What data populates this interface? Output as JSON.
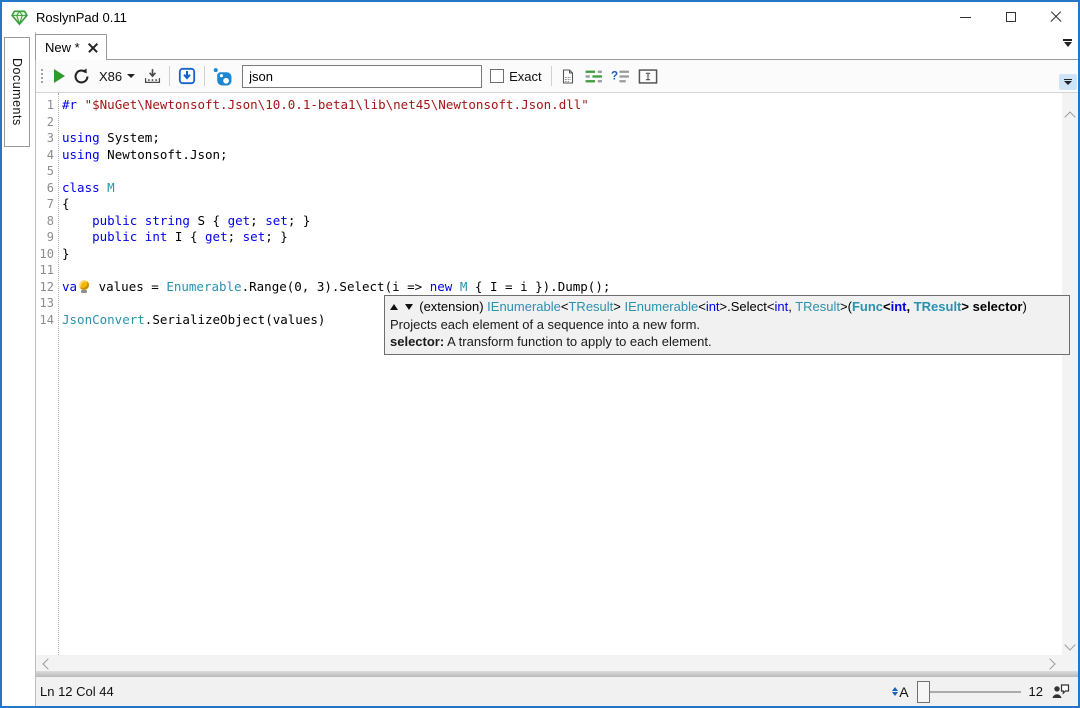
{
  "window": {
    "title": "RoslynPad 0.11",
    "controls": [
      "minimize",
      "maximize",
      "close"
    ]
  },
  "sidebar": {
    "documents_label": "Documents"
  },
  "tabs": {
    "active_label": "New *",
    "close_icon": "x",
    "tab_list_icon": "dropdown-with-bar"
  },
  "toolbar": {
    "run_icon": "green-play-triangle",
    "restart_icon": "circular-arrow",
    "platform_label": "X86",
    "package_icon": "arrow-into-tray",
    "import_icon": "arrow-into-box",
    "nuget_icon": "nuget-logo",
    "search_value": "json",
    "exact_label": "Exact",
    "format_icon": "format-document",
    "comment_icon": "comment-selection",
    "uncomment_icon": "uncomment-selection",
    "rename_icon": "rename-box",
    "overflow_icon": "toolbar-overflow-dropdown"
  },
  "editor": {
    "lines": [
      {
        "n": "1",
        "seg": [
          {
            "t": "#r",
            "c": "k"
          },
          {
            "t": " ",
            "c": "p"
          },
          {
            "t": "\"$NuGet\\Newtonsoft.Json\\10.0.1-beta1\\lib\\net45\\Newtonsoft.Json.dll\"",
            "c": "s"
          }
        ]
      },
      {
        "n": "2",
        "seg": []
      },
      {
        "n": "3",
        "seg": [
          {
            "t": "using",
            "c": "k"
          },
          {
            "t": " System;",
            "c": "p"
          }
        ]
      },
      {
        "n": "4",
        "seg": [
          {
            "t": "using",
            "c": "k"
          },
          {
            "t": " Newtonsoft.Json;",
            "c": "p"
          }
        ]
      },
      {
        "n": "5",
        "seg": []
      },
      {
        "n": "6",
        "seg": [
          {
            "t": "class",
            "c": "k"
          },
          {
            "t": " ",
            "c": "p"
          },
          {
            "t": "M",
            "c": "t"
          }
        ]
      },
      {
        "n": "7",
        "seg": [
          {
            "t": "{",
            "c": "p"
          }
        ]
      },
      {
        "n": "8",
        "seg": [
          {
            "t": "    ",
            "c": "p"
          },
          {
            "t": "public",
            "c": "k"
          },
          {
            "t": " ",
            "c": "p"
          },
          {
            "t": "string",
            "c": "k"
          },
          {
            "t": " S { ",
            "c": "p"
          },
          {
            "t": "get",
            "c": "k"
          },
          {
            "t": "; ",
            "c": "p"
          },
          {
            "t": "set",
            "c": "k"
          },
          {
            "t": "; }",
            "c": "p"
          }
        ]
      },
      {
        "n": "9",
        "seg": [
          {
            "t": "    ",
            "c": "p"
          },
          {
            "t": "public",
            "c": "k"
          },
          {
            "t": " ",
            "c": "p"
          },
          {
            "t": "int",
            "c": "k"
          },
          {
            "t": " I { ",
            "c": "p"
          },
          {
            "t": "get",
            "c": "k"
          },
          {
            "t": "; ",
            "c": "p"
          },
          {
            "t": "set",
            "c": "k"
          },
          {
            "t": "; }",
            "c": "p"
          }
        ]
      },
      {
        "n": "10",
        "seg": [
          {
            "t": "}",
            "c": "p"
          }
        ]
      },
      {
        "n": "11",
        "seg": []
      },
      {
        "n": "12",
        "seg": [
          {
            "t": "va",
            "c": "k"
          },
          {
            "c": "bulb"
          },
          {
            "t": " values = ",
            "c": "p"
          },
          {
            "t": "Enumerable",
            "c": "t"
          },
          {
            "t": ".Range(0, 3).Select(i => ",
            "c": "p"
          },
          {
            "t": "new",
            "c": "k"
          },
          {
            "t": " ",
            "c": "p"
          },
          {
            "t": "M",
            "c": "t"
          },
          {
            "t": " { I = i }).Dump();",
            "c": "p"
          }
        ]
      },
      {
        "n": "13",
        "seg": []
      },
      {
        "n": "14",
        "seg": [
          {
            "t": "JsonConvert",
            "c": "t"
          },
          {
            "t": ".SerializeObject(values)",
            "c": "p"
          }
        ]
      }
    ],
    "colors": {
      "keyword": "#0000ee",
      "type": "#2b91af",
      "string": "#a31515",
      "plain": "#000000",
      "line_number": "#8c8c8c"
    }
  },
  "tooltip": {
    "signature": [
      {
        "t": "(extension) ",
        "c": "p"
      },
      {
        "t": "IEnumerable",
        "c": "t"
      },
      {
        "t": "<",
        "c": "p"
      },
      {
        "t": "TResult",
        "c": "t"
      },
      {
        "t": "> ",
        "c": "p"
      },
      {
        "t": "IEnumerable",
        "c": "t"
      },
      {
        "t": "<",
        "c": "p"
      },
      {
        "t": "int",
        "c": "k"
      },
      {
        "t": ">.Select<",
        "c": "p"
      },
      {
        "t": "int",
        "c": "k"
      },
      {
        "t": ", ",
        "c": "p"
      },
      {
        "t": "TResult",
        "c": "t"
      },
      {
        "t": ">(",
        "c": "p"
      },
      {
        "t": "Func",
        "c": "t",
        "b": 1
      },
      {
        "t": "<",
        "c": "p",
        "b": 1
      },
      {
        "t": "int",
        "c": "k",
        "b": 1
      },
      {
        "t": ", ",
        "c": "p",
        "b": 1
      },
      {
        "t": "TResult",
        "c": "t",
        "b": 1
      },
      {
        "t": "> ",
        "c": "p",
        "b": 1
      },
      {
        "t": "selector",
        "c": "p",
        "b": 1
      },
      {
        "t": ")",
        "c": "p"
      }
    ],
    "description": "Projects each element of a sequence into a new form.",
    "param_name": "selector:",
    "param_desc": " A transform function to apply to each element."
  },
  "statusbar": {
    "position": "Ln 12 Col 44",
    "font_size_letter": "A",
    "zoom_value": "12",
    "feedback_icon": "person-with-speech-bubble"
  }
}
